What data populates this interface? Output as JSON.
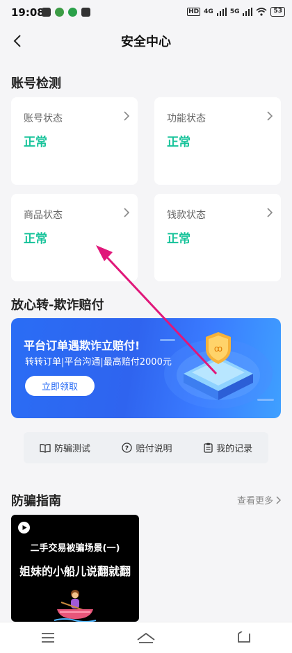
{
  "status_bar": {
    "time": "19:08",
    "battery": "53",
    "net_hd": "HD",
    "net_4g": "4G",
    "net_5g": "5G"
  },
  "nav": {
    "title": "安全中心"
  },
  "account_check": {
    "section_title": "账号检测",
    "cards": [
      {
        "label": "账号状态",
        "value": "正常"
      },
      {
        "label": "功能状态",
        "value": "正常"
      },
      {
        "label": "商品状态",
        "value": "正常"
      },
      {
        "label": "钱款状态",
        "value": "正常"
      }
    ]
  },
  "fraud_guarantee": {
    "section_title": "放心转-欺诈赔付",
    "banner": {
      "title": "平台订单遇欺诈立赔付!",
      "subtitle": "转转订单|平台沟通|最高赔付2000元",
      "button": "立即领取"
    },
    "quick_links": [
      {
        "label": "防骗测试",
        "icon": "book-icon"
      },
      {
        "label": "赔付说明",
        "icon": "question-circle-icon"
      },
      {
        "label": "我的记录",
        "icon": "clipboard-icon"
      }
    ]
  },
  "anti_fraud_guide": {
    "section_title": "防骗指南",
    "more_label": "查看更多",
    "video": {
      "line1": "二手交易被骗场景(一)",
      "line2": "姐妹的小船儿说翻就翻"
    }
  },
  "bottom_nav": {
    "items": [
      "menu-icon",
      "home-icon",
      "back-icon"
    ]
  },
  "colors": {
    "status_normal": "#17c39a",
    "banner_blue": "#2a6df5",
    "annotation_arrow": "#e0177a"
  }
}
